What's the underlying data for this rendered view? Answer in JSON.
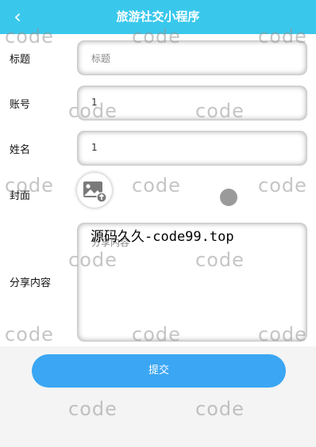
{
  "header": {
    "title": "旅游社交小程序",
    "back_icon": "chevron-left-icon"
  },
  "form": {
    "title_label": "标题",
    "title_placeholder": "标题",
    "account_label": "账号",
    "account_value": "1",
    "name_label": "姓名",
    "name_value": "1",
    "cover_label": "封面",
    "cover_icon": "image-upload-icon",
    "content_label": "分享内容",
    "content_placeholder": "分享内容"
  },
  "overlay_text": "源码久久-code99.top",
  "watermark_text": "code",
  "submit_label": "提交",
  "colors": {
    "header": "#39c8ec",
    "submit": "#3ba6f3"
  }
}
